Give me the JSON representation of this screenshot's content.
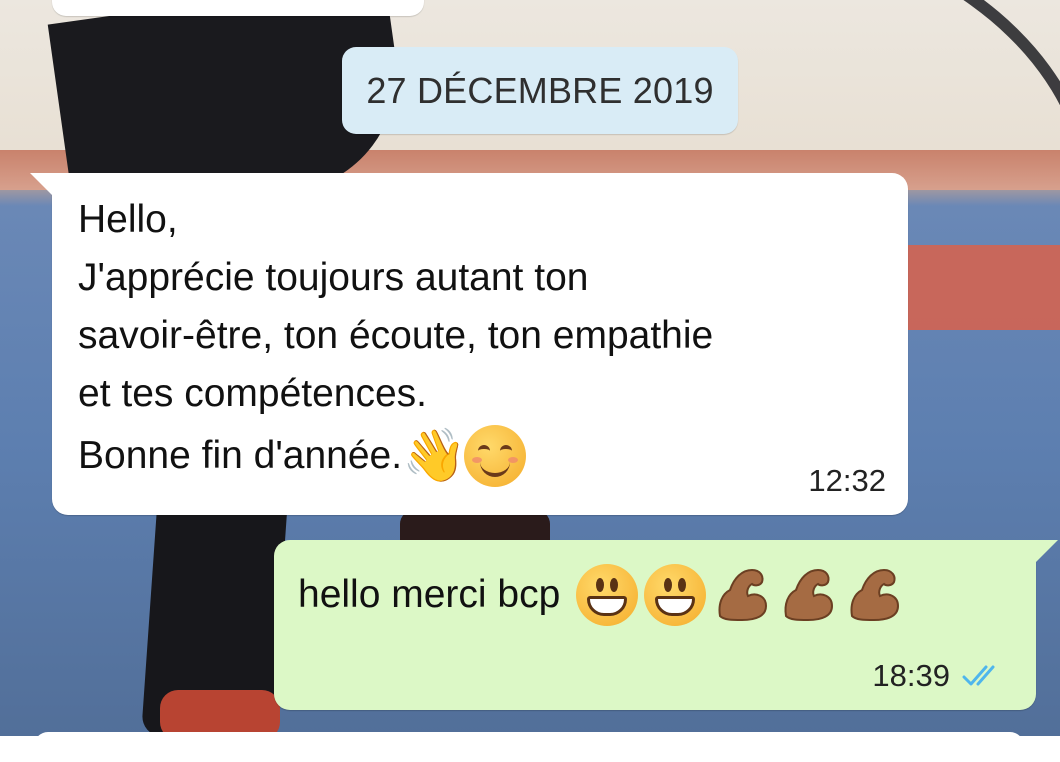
{
  "date_separator": "27 DÉCEMBRE 2019",
  "incoming_message": {
    "lines": "Hello,\nJ'apprécie toujours autant ton\nsavoir-être, ton écoute, ton empathie\net tes compétences.",
    "last_line": "Bonne fin d'année.",
    "emojis": [
      "waving-hand",
      "smiling-face"
    ],
    "time": "12:32"
  },
  "outgoing_message": {
    "text": "hello merci bcp",
    "emojis": [
      "grinning-face",
      "grinning-face",
      "flexed-biceps",
      "flexed-biceps",
      "flexed-biceps"
    ],
    "time": "18:39",
    "status": "read-double-check"
  },
  "colors": {
    "incoming_bubble": "#ffffff",
    "outgoing_bubble": "#dcf8c6",
    "date_chip": "#d9ecf6",
    "read_ticks": "#4fb6ec"
  }
}
